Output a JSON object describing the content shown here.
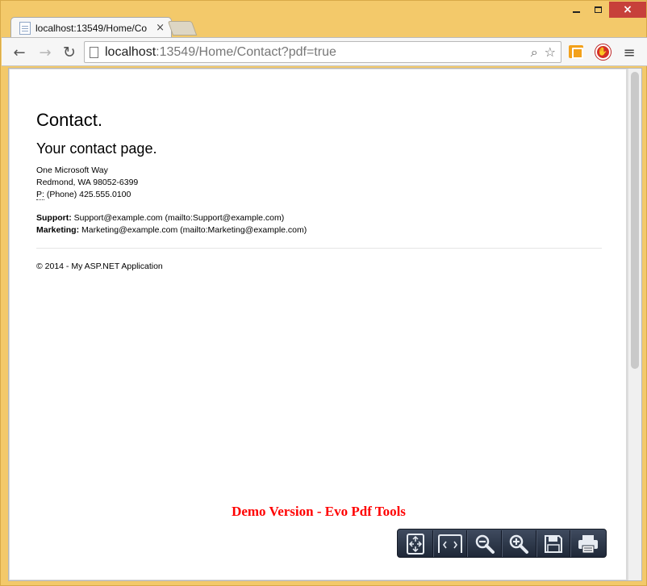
{
  "window": {
    "minimize_label": "minimize",
    "maximize_label": "maximize",
    "close_label": "×"
  },
  "tab": {
    "title": "localhost:13549/Home/Co",
    "close": "×"
  },
  "toolbar": {
    "back": "←",
    "forward": "→",
    "reload": "↻",
    "url_host": "localhost",
    "url_path": ":13549/Home/Contact?pdf=true",
    "search_glyph": "⌕",
    "star_glyph": "☆",
    "menu_glyph": "≡",
    "ext2_glyph": "✋"
  },
  "page": {
    "heading": "Contact.",
    "subheading": "Your contact page.",
    "address_line1": "One Microsoft Way",
    "address_line2": "Redmond, WA 98052-6399",
    "phone_abbr": "P:",
    "phone_text": " (Phone) 425.555.0100",
    "support_label": "Support:",
    "support_text": " Support@example.com (mailto:Support@example.com)",
    "marketing_label": "Marketing:",
    "marketing_text": " Marketing@example.com (mailto:Marketing@example.com)",
    "footer": "© 2014 - My ASP.NET Application",
    "watermark": "Demo Version - Evo Pdf Tools"
  },
  "pdf_toolbar": {
    "buttons": [
      "fit-page-icon",
      "fit-width-icon",
      "zoom-out-icon",
      "zoom-in-icon",
      "save-icon",
      "print-icon"
    ]
  }
}
